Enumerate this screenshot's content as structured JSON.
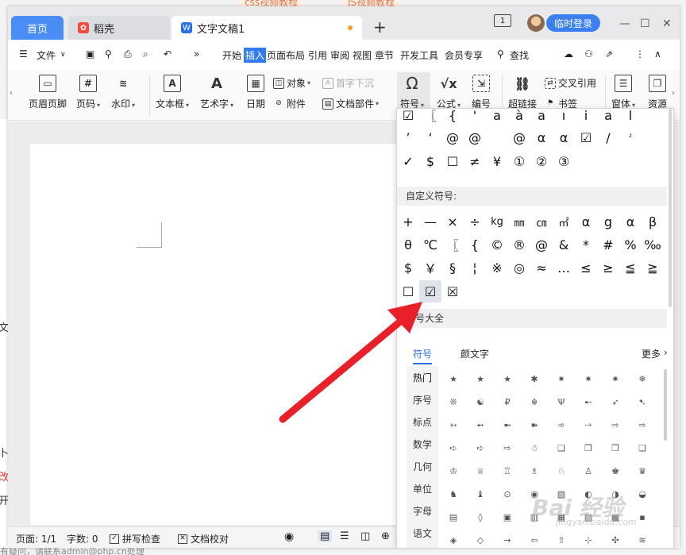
{
  "background": {
    "top_tags": [
      "css视频教程",
      "JS视频教程"
    ],
    "left_fragments": [
      "文",
      "卜",
      "改",
      "开"
    ],
    "bottom_text": "有疑问，请联系admin@php.cn处理"
  },
  "titlebar": {
    "tabs": [
      {
        "label": "首页",
        "active": false
      },
      {
        "label": "稻壳",
        "active": false
      },
      {
        "label": "文字文稿1",
        "active": true
      }
    ],
    "add_tab": "+",
    "badge": "1",
    "login_label": "临时登录",
    "controls": [
      "—",
      "☐",
      "✕"
    ]
  },
  "menu": {
    "file": "文件",
    "items": [
      "开始",
      "插入",
      "页面布局",
      "引用",
      "审阅",
      "视图",
      "章节",
      "开发工具",
      "会员专享"
    ],
    "active": "插入",
    "search": "查找"
  },
  "ribbon": {
    "items": [
      "页眉页脚",
      "页码",
      "水印",
      "文本框",
      "艺术字",
      "日期",
      "符号",
      "公式",
      "编号",
      "超链接",
      "窗体",
      "资源"
    ],
    "small_items": [
      "对象",
      "附件",
      "首字下沉",
      "文档部件",
      "交叉引用",
      "书签"
    ]
  },
  "statusbar": {
    "page": "页面: 1/1",
    "words": "字数: 0",
    "spell": "拼写检查",
    "proof": "文档校对"
  },
  "symbols": {
    "recent_row1": [
      "☑",
      "〖",
      "{",
      "'",
      "a",
      "à",
      "a",
      "ı",
      "i",
      "a",
      "l"
    ],
    "recent_row2": [
      "’",
      "‘",
      "@",
      "@",
      "",
      "@",
      "α",
      "α",
      "☑",
      "/",
      "²"
    ],
    "recent_row3": [
      "✓",
      "$",
      "☐",
      "≠",
      "¥",
      "①",
      "②",
      "③"
    ],
    "custom_label": "自定义符号:",
    "custom_row1": [
      "+",
      "—",
      "×",
      "÷",
      "kg",
      "㎜",
      "㎝",
      "㎡",
      "α",
      "g",
      "α",
      "β"
    ],
    "custom_row2": [
      "θ",
      "℃",
      "〖",
      "{",
      "©",
      "®",
      "@",
      "&",
      "*",
      "#",
      "%",
      "‰"
    ],
    "custom_row3": [
      "$",
      "￥",
      "§",
      "¦",
      "※",
      "◎",
      "≈",
      "…",
      "≤",
      "≥",
      "≦",
      "≧"
    ],
    "custom_row4": [
      "☐",
      "☑",
      "☒"
    ],
    "all_label": "符号大全",
    "tabs": [
      "符号",
      "颜文字"
    ],
    "more": "更多",
    "categories": [
      "热门",
      "序号",
      "标点",
      "数学",
      "几何",
      "单位",
      "字母",
      "语文"
    ],
    "grid": [
      [
        "★",
        "★",
        "★",
        "✱",
        "✷",
        "✷",
        "✷",
        "❄"
      ],
      [
        "❊",
        "☯",
        "₽",
        "☬",
        "Ψ",
        "➸",
        "➶",
        "➷"
      ],
      [
        "➳",
        "➻",
        "➼",
        "➽",
        "➾",
        "⤑",
        "⇨",
        "⇨"
      ],
      [
        "➪",
        "➪",
        "⇨",
        "☃",
        "❏",
        "❐",
        "❒",
        "❑"
      ],
      [
        "♔",
        "♕",
        "♖",
        "♗",
        "♘",
        "♙",
        "♚",
        "♛"
      ],
      [
        "♞",
        "♝",
        "⊙",
        "◉",
        "▧",
        "◐",
        "◑",
        "◒"
      ],
      [
        "▤",
        "◊",
        "▣",
        "▥",
        "▦",
        "▨",
        "▩",
        "▪"
      ],
      [
        "◈",
        "◇",
        "→",
        "⇦",
        "⇧",
        "⊹",
        "✣",
        "≋"
      ]
    ]
  },
  "watermark": {
    "text": "Bai 经验",
    "sub": "jingyan.baidu.com"
  }
}
